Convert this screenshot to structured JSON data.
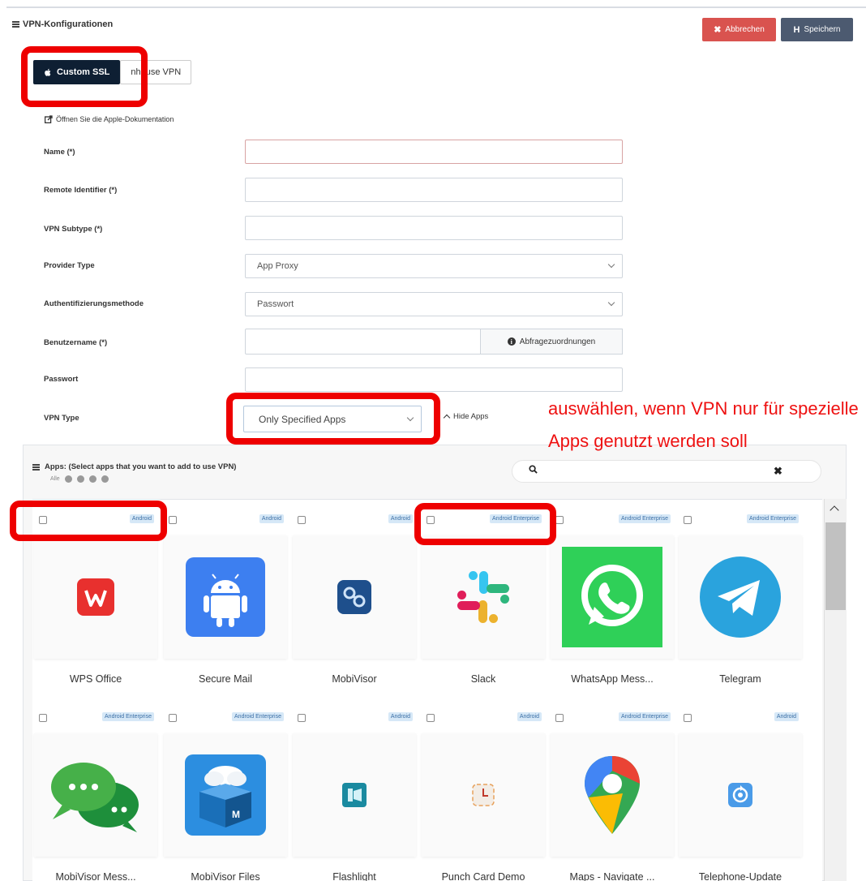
{
  "header": {
    "title": "VPN-Konfigurationen",
    "cancel_label": "Abbrechen",
    "save_label": "Speichern",
    "cancel_color": "#d9534f",
    "save_color": "#4c5a70"
  },
  "tabs": [
    {
      "label": "Custom SSL",
      "active": true
    },
    {
      "label": "nhouse VPN",
      "active": false
    }
  ],
  "doc_link": "Öffnen Sie die Apple-Dokumentation",
  "form": {
    "name_label": "Name (*)",
    "name_value": "",
    "remote_id_label": "Remote Identifier (*)",
    "remote_id_value": "",
    "vpn_subtype_label": "VPN Subtype (*)",
    "vpn_subtype_value": "",
    "provider_type_label": "Provider Type",
    "provider_type_value": "App Proxy",
    "auth_label": "Authentifizierungsmethode",
    "auth_value": "Passwort",
    "username_label": "Benutzername (*)",
    "username_value": "",
    "query_mapping_label": "Abfragezuordnungen",
    "password_label": "Passwort",
    "password_value": "",
    "vpn_type_label": "VPN Type",
    "vpn_type_value": "Only Specified Apps",
    "hide_apps_label": "Hide Apps"
  },
  "annotation": "auswählen, wenn VPN nur für spezielle Apps genutzt werden soll",
  "apps": {
    "title": "Apps: (Select apps that you want to add to use VPN)",
    "filter_all": "Alle",
    "items": [
      {
        "name": "WPS Office",
        "badge": "Android",
        "icon": "wps-office-icon"
      },
      {
        "name": "Secure Mail",
        "badge": "Android",
        "icon": "android-robot-icon"
      },
      {
        "name": "MobiVisor",
        "badge": "Android",
        "icon": "mobivisor-icon"
      },
      {
        "name": "Slack",
        "badge": "Android Enterprise",
        "icon": "slack-icon"
      },
      {
        "name": "WhatsApp Mess...",
        "badge": "Android Enterprise",
        "icon": "whatsapp-icon"
      },
      {
        "name": "Telegram",
        "badge": "Android Enterprise",
        "icon": "telegram-icon"
      },
      {
        "name": "MobiVisor Mess...",
        "badge": "Android Enterprise",
        "icon": "chat-bubbles-icon"
      },
      {
        "name": "MobiVisor Files",
        "badge": "Android Enterprise",
        "icon": "cloud-box-icon"
      },
      {
        "name": "Flashlight",
        "badge": "Android",
        "icon": "flashlight-icon"
      },
      {
        "name": "Punch Card Demo",
        "badge": "Android",
        "icon": "clock-icon"
      },
      {
        "name": "Maps - Navigate ...",
        "badge": "Android Enterprise",
        "icon": "maps-pin-icon"
      },
      {
        "name": "Telephone-Update",
        "badge": "Android",
        "icon": "update-icon"
      }
    ]
  },
  "colors": {
    "annotation_red": "#ee1111",
    "active_tab": "#0e1f33",
    "badge_bg": "#d6e8f7"
  }
}
